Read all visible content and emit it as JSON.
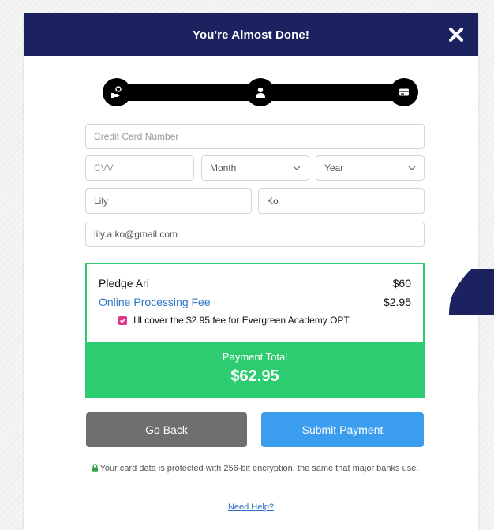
{
  "header": {
    "title": "You're Almost Done!",
    "close_icon": "close-icon"
  },
  "stepper": {
    "steps": [
      {
        "icon": "hand-coin-icon",
        "active": true
      },
      {
        "icon": "user-icon",
        "active": true
      },
      {
        "icon": "credit-card-icon",
        "active": true
      }
    ]
  },
  "form": {
    "card_number": {
      "value": "",
      "placeholder": "Credit Card Number"
    },
    "cvv": {
      "value": "",
      "placeholder": "CVV"
    },
    "month": {
      "selected": "Month"
    },
    "year": {
      "selected": "Year"
    },
    "first_name": {
      "value": "Lily",
      "placeholder": ""
    },
    "last_name": {
      "value": "Ko",
      "placeholder": ""
    },
    "email": {
      "value": "lily.a.ko@gmail.com",
      "placeholder": ""
    }
  },
  "summary": {
    "pledge_label": "Pledge Ari",
    "pledge_amount": "$60",
    "fee_label": "Online Processing Fee",
    "fee_amount": "$2.95",
    "cover_fee_text": "I'll cover the $2.95 fee for Evergreen Academy OPT.",
    "cover_fee_checked": true,
    "total_label": "Payment Total",
    "total_amount": "$62.95"
  },
  "actions": {
    "back_label": "Go Back",
    "submit_label": "Submit Payment"
  },
  "footer": {
    "secure_text": "Your card data is protected with 256-bit encryption, the same that major banks use.",
    "help_label": "Need Help?"
  },
  "colors": {
    "header_bg": "#1c2260",
    "accent_green": "#2ecc71",
    "submit_blue": "#3b9dee",
    "back_gray": "#6f6f6f",
    "checkbox_pink": "#e0338a",
    "link_blue": "#2d77c8"
  }
}
